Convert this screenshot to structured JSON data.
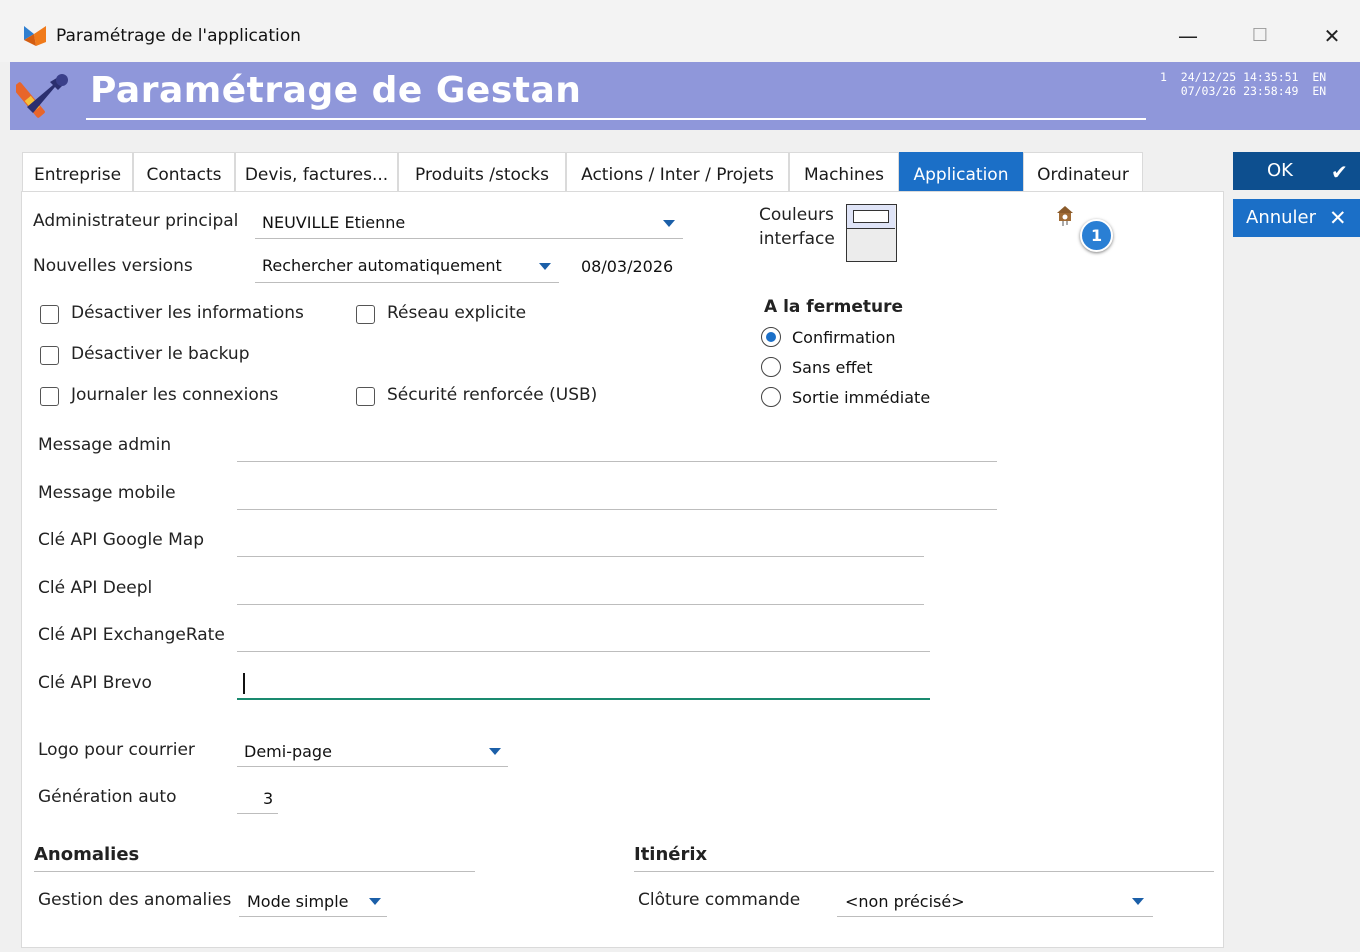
{
  "window": {
    "title": "Paramétrage de l'application",
    "minimize": "—",
    "maximize": "☐",
    "close": "✕"
  },
  "header": {
    "title": "Paramétrage de Gestan",
    "info": "1  24/12/25 14:35:51  EN\n   07/03/26 23:58:49  EN"
  },
  "tabs": [
    {
      "label": "Entreprise"
    },
    {
      "label": "Contacts"
    },
    {
      "label": "Devis, factures..."
    },
    {
      "label": "Produits /stocks"
    },
    {
      "label": "Actions / Inter / Projets"
    },
    {
      "label": "Machines"
    },
    {
      "label": "Application",
      "active": true
    },
    {
      "label": "Ordinateur"
    }
  ],
  "buttons": {
    "ok": "OK",
    "ok_icon": "✔",
    "cancel": "Annuler",
    "cancel_icon": "✕"
  },
  "form": {
    "admin_label": "Administrateur principal",
    "admin_value": "NEUVILLE Etienne",
    "versions_label": "Nouvelles versions",
    "versions_value": "Rechercher automatiquement",
    "versions_date": "08/03/2026",
    "colors_label_1": "Couleurs",
    "colors_label_2": "interface",
    "badge": "1",
    "checkboxes": {
      "disable_info": "Désactiver les informations",
      "explicit_network": "Réseau explicite",
      "disable_backup": "Désactiver le backup",
      "log_connections": "Journaler les connexions",
      "secure_usb": "Sécurité renforcée (USB)"
    },
    "closing": {
      "title": "A la fermeture",
      "options": [
        "Confirmation",
        "Sans effet",
        "Sortie immédiate"
      ],
      "selected": "Confirmation"
    },
    "message_admin_label": "Message admin",
    "message_mobile_label": "Message mobile",
    "google_map_label": "Clé API Google Map",
    "deepl_label": "Clé API Deepl",
    "exchange_label": "Clé API ExchangeRate",
    "brevo_label": "Clé API Brevo",
    "logo_label": "Logo pour courrier",
    "logo_value": "Demi-page",
    "generation_label": "Génération auto",
    "generation_value": "3"
  },
  "anomalies": {
    "title": "Anomalies",
    "label": "Gestion des anomalies",
    "value": "Mode simple"
  },
  "itinerix": {
    "title": "Itinérix",
    "label": "Clôture commande",
    "value": "<non précisé>"
  },
  "icons": {
    "app": "app-logo-icon",
    "header": "tools-icon",
    "cuckoo": "cuckoo-clock-icon"
  },
  "colors": {
    "header_bg": "#8f97da",
    "accent": "#1b6fc7",
    "ok_button": "#0d4f8f",
    "active_input_line": "#1a8a6f"
  }
}
